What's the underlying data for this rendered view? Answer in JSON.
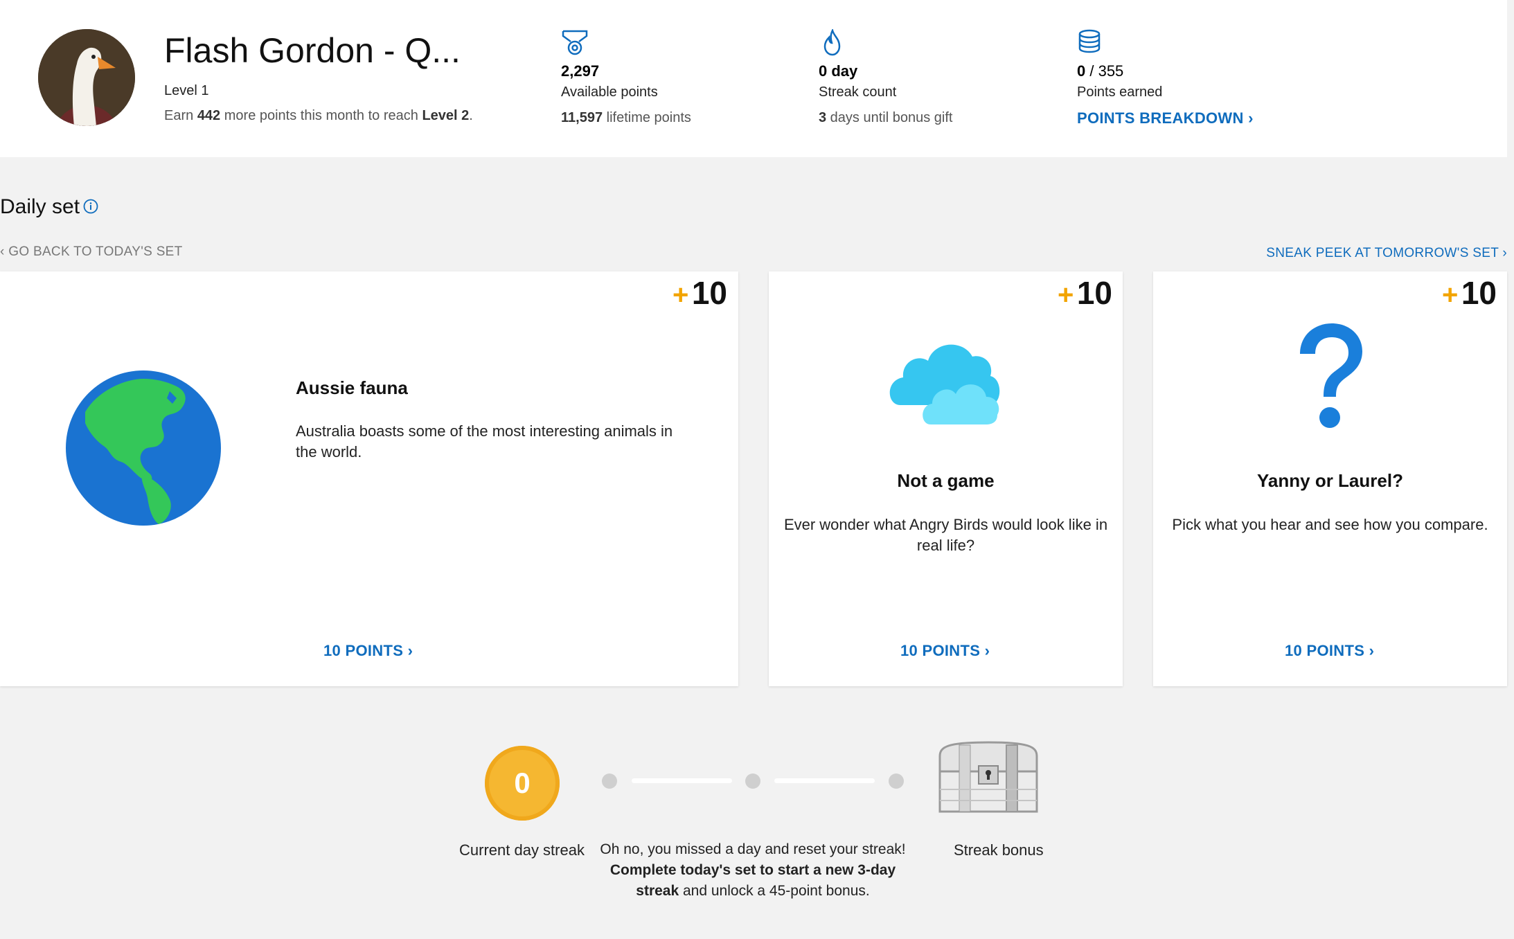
{
  "header": {
    "user_name": "Flash Gordon - Q...",
    "level": "Level 1",
    "earn_prefix": "Earn ",
    "earn_points": "442",
    "earn_middle": " more points this month to reach ",
    "earn_level": "Level 2",
    "earn_suffix": "."
  },
  "stats": {
    "available": {
      "icon": "medal-icon",
      "value": "2,297",
      "label": "Available points",
      "sub_value": "11,597",
      "sub_text": " lifetime points"
    },
    "streak": {
      "icon": "flame-icon",
      "value": "0 day",
      "label": "Streak count",
      "sub_value": "3",
      "sub_text": " days until bonus gift"
    },
    "earned": {
      "icon": "coins-icon",
      "value": "0",
      "value_total": " / 355",
      "label": "Points earned",
      "link": "POINTS BREAKDOWN"
    }
  },
  "daily_set": {
    "title": "Daily set",
    "back_link": "GO BACK TO TODAY'S SET",
    "peek_link": "SNEAK PEEK AT TOMORROW'S SET",
    "cards": [
      {
        "icon": "globe-icon",
        "plus": "+",
        "points": "10",
        "title": "Aussie fauna",
        "description": "Australia boasts some of the most interesting animals in the world.",
        "link": "10 POINTS"
      },
      {
        "icon": "cloud-icon",
        "plus": "+",
        "points": "10",
        "title": "Not a game",
        "description": "Ever wonder what Angry Birds would look like in real life?",
        "link": "10 POINTS"
      },
      {
        "icon": "question-mark-icon",
        "plus": "+",
        "points": "10",
        "title": "Yanny or Laurel?",
        "description": "Pick what you hear and see how you compare.",
        "link": "10 POINTS"
      }
    ]
  },
  "streak_section": {
    "coin_value": "0",
    "current_label": "Current day streak",
    "message_part1": "Oh no, you missed a day and reset your streak! ",
    "message_bold": "Complete today's set to start a new 3-day streak",
    "message_part2": " and unlock a 45-point bonus.",
    "bonus_label": "Streak bonus",
    "progress": {
      "completed_days": 0,
      "total_days": 3
    }
  },
  "colors": {
    "accent_blue": "#0f6cbd",
    "plus_gold": "#f2a400",
    "coin_gold": "#f5b731",
    "page_bg": "#f2f2f2"
  }
}
